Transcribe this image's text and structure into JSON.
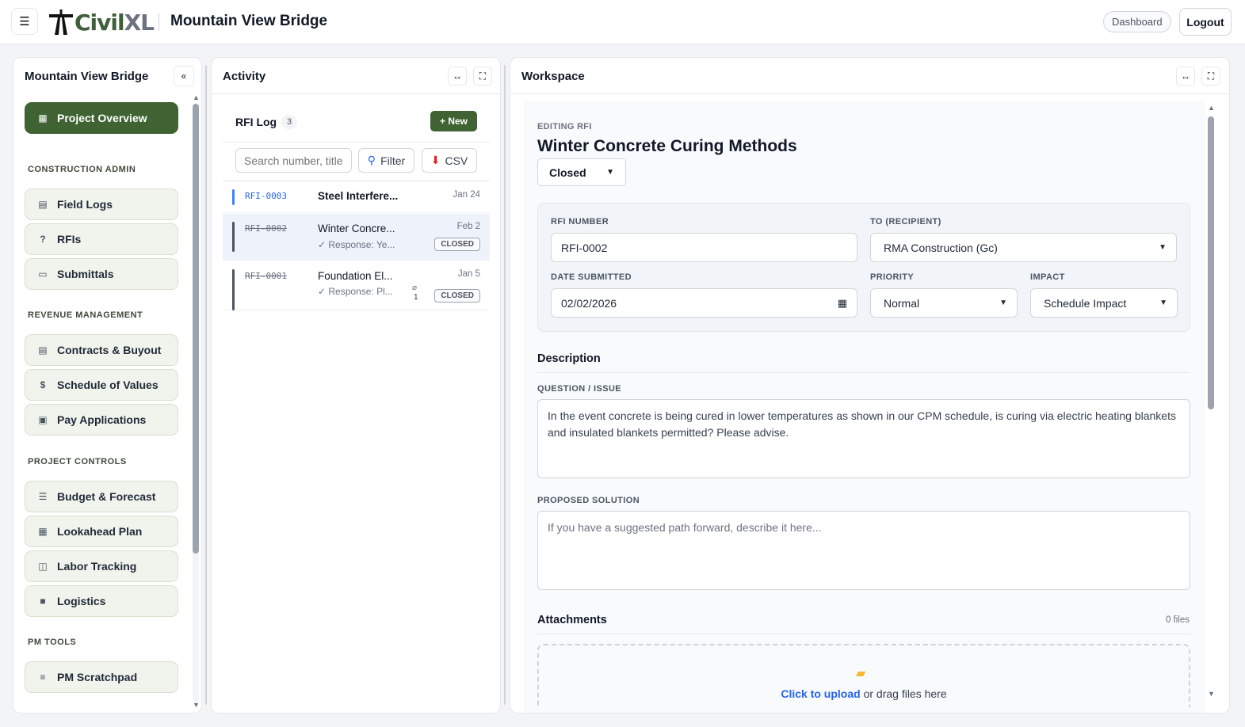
{
  "header": {
    "menu_icon": "☰",
    "logo_main": "Civil",
    "logo_accent": "XL",
    "project_title": "Mountain View Bridge",
    "dashboard_label": "Dashboard",
    "logout_label": "Logout"
  },
  "sidebar": {
    "title": "Mountain View Bridge",
    "collapse_icon": "«",
    "overview_label": "Project Overview",
    "sections": {
      "construction_admin": "CONSTRUCTION ADMIN",
      "revenue_management": "REVENUE MANAGEMENT",
      "project_controls": "PROJECT CONTROLS",
      "pm_tools": "PM TOOLS"
    },
    "items": {
      "field_logs": "Field Logs",
      "rfis": "RFIs",
      "submittals": "Submittals",
      "contracts": "Contracts & Buyout",
      "sov": "Schedule of Values",
      "pay_apps": "Pay Applications",
      "budget": "Budget & Forecast",
      "lookahead": "Lookahead Plan",
      "labor": "Labor Tracking",
      "logistics": "Logistics",
      "scratchpad": "PM Scratchpad"
    }
  },
  "activity": {
    "title": "Activity",
    "log_title": "RFI Log",
    "count": "3",
    "new_label": "+ New",
    "search_placeholder": "Search number, title,",
    "filter_label": "Filter",
    "csv_label": "CSV",
    "rows": [
      {
        "number": "RFI-0003",
        "title": "Steel Interfere...",
        "date": "Jan 24"
      },
      {
        "number": "RFI-0002",
        "title": "Winter Concre...",
        "response": "✓ Response: Ye...",
        "date": "Feb 2",
        "status": "CLOSED"
      },
      {
        "number": "RFI-0001",
        "title": "Foundation El...",
        "response": "✓ Response: Pl...",
        "attachments": "1",
        "date": "Jan 5",
        "status": "CLOSED"
      }
    ]
  },
  "workspace": {
    "title": "Workspace",
    "editing_label": "EDITING RFI",
    "rfi_title": "Winter Concrete Curing Methods",
    "status_value": "Closed",
    "rfi_number_label": "RFI NUMBER",
    "rfi_number": "RFI-0002",
    "to_label": "TO (RECIPIENT)",
    "to_value": "RMA Construction (Gc)",
    "date_label": "DATE SUBMITTED",
    "date_value": "02/02/2026",
    "priority_label": "PRIORITY",
    "priority_value": "Normal",
    "impact_label": "IMPACT",
    "impact_value": "Schedule Impact",
    "description_heading": "Description",
    "question_label": "QUESTION / ISSUE",
    "question_text": "In the event concrete is being cured in lower temperatures as shown in our CPM schedule, is curing via electric heating blankets and insulated blankets permitted? Please advise.",
    "solution_label": "PROPOSED SOLUTION",
    "solution_placeholder": "If you have a suggested path forward, describe it here...",
    "attachments_heading": "Attachments",
    "files_count": "0 files",
    "upload_link": "Click to upload",
    "upload_rest": " or drag files here"
  },
  "colors": {
    "brand_green": "#3f6332",
    "link_blue": "#2563eb",
    "selected_row": "#eef2fb"
  }
}
